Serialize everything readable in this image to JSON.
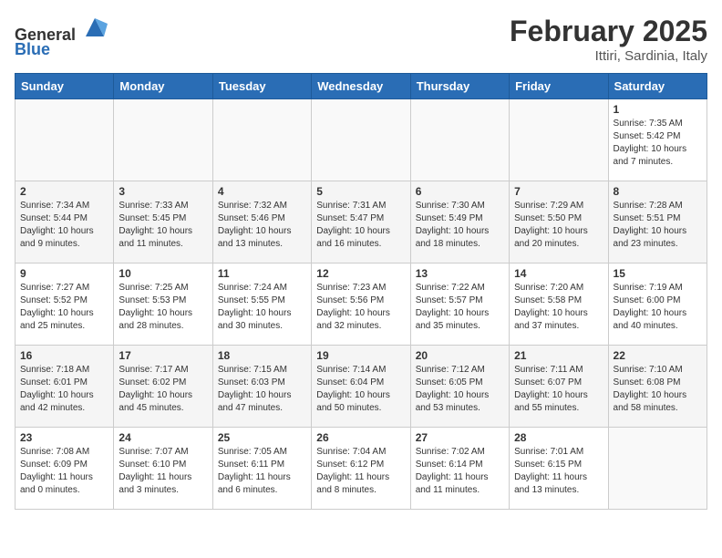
{
  "header": {
    "logo_line1": "General",
    "logo_line2": "Blue",
    "month_title": "February 2025",
    "location": "Ittiri, Sardinia, Italy"
  },
  "days_of_week": [
    "Sunday",
    "Monday",
    "Tuesday",
    "Wednesday",
    "Thursday",
    "Friday",
    "Saturday"
  ],
  "weeks": [
    [
      {
        "day": "",
        "info": ""
      },
      {
        "day": "",
        "info": ""
      },
      {
        "day": "",
        "info": ""
      },
      {
        "day": "",
        "info": ""
      },
      {
        "day": "",
        "info": ""
      },
      {
        "day": "",
        "info": ""
      },
      {
        "day": "1",
        "info": "Sunrise: 7:35 AM\nSunset: 5:42 PM\nDaylight: 10 hours\nand 7 minutes."
      }
    ],
    [
      {
        "day": "2",
        "info": "Sunrise: 7:34 AM\nSunset: 5:44 PM\nDaylight: 10 hours\nand 9 minutes."
      },
      {
        "day": "3",
        "info": "Sunrise: 7:33 AM\nSunset: 5:45 PM\nDaylight: 10 hours\nand 11 minutes."
      },
      {
        "day": "4",
        "info": "Sunrise: 7:32 AM\nSunset: 5:46 PM\nDaylight: 10 hours\nand 13 minutes."
      },
      {
        "day": "5",
        "info": "Sunrise: 7:31 AM\nSunset: 5:47 PM\nDaylight: 10 hours\nand 16 minutes."
      },
      {
        "day": "6",
        "info": "Sunrise: 7:30 AM\nSunset: 5:49 PM\nDaylight: 10 hours\nand 18 minutes."
      },
      {
        "day": "7",
        "info": "Sunrise: 7:29 AM\nSunset: 5:50 PM\nDaylight: 10 hours\nand 20 minutes."
      },
      {
        "day": "8",
        "info": "Sunrise: 7:28 AM\nSunset: 5:51 PM\nDaylight: 10 hours\nand 23 minutes."
      }
    ],
    [
      {
        "day": "9",
        "info": "Sunrise: 7:27 AM\nSunset: 5:52 PM\nDaylight: 10 hours\nand 25 minutes."
      },
      {
        "day": "10",
        "info": "Sunrise: 7:25 AM\nSunset: 5:53 PM\nDaylight: 10 hours\nand 28 minutes."
      },
      {
        "day": "11",
        "info": "Sunrise: 7:24 AM\nSunset: 5:55 PM\nDaylight: 10 hours\nand 30 minutes."
      },
      {
        "day": "12",
        "info": "Sunrise: 7:23 AM\nSunset: 5:56 PM\nDaylight: 10 hours\nand 32 minutes."
      },
      {
        "day": "13",
        "info": "Sunrise: 7:22 AM\nSunset: 5:57 PM\nDaylight: 10 hours\nand 35 minutes."
      },
      {
        "day": "14",
        "info": "Sunrise: 7:20 AM\nSunset: 5:58 PM\nDaylight: 10 hours\nand 37 minutes."
      },
      {
        "day": "15",
        "info": "Sunrise: 7:19 AM\nSunset: 6:00 PM\nDaylight: 10 hours\nand 40 minutes."
      }
    ],
    [
      {
        "day": "16",
        "info": "Sunrise: 7:18 AM\nSunset: 6:01 PM\nDaylight: 10 hours\nand 42 minutes."
      },
      {
        "day": "17",
        "info": "Sunrise: 7:17 AM\nSunset: 6:02 PM\nDaylight: 10 hours\nand 45 minutes."
      },
      {
        "day": "18",
        "info": "Sunrise: 7:15 AM\nSunset: 6:03 PM\nDaylight: 10 hours\nand 47 minutes."
      },
      {
        "day": "19",
        "info": "Sunrise: 7:14 AM\nSunset: 6:04 PM\nDaylight: 10 hours\nand 50 minutes."
      },
      {
        "day": "20",
        "info": "Sunrise: 7:12 AM\nSunset: 6:05 PM\nDaylight: 10 hours\nand 53 minutes."
      },
      {
        "day": "21",
        "info": "Sunrise: 7:11 AM\nSunset: 6:07 PM\nDaylight: 10 hours\nand 55 minutes."
      },
      {
        "day": "22",
        "info": "Sunrise: 7:10 AM\nSunset: 6:08 PM\nDaylight: 10 hours\nand 58 minutes."
      }
    ],
    [
      {
        "day": "23",
        "info": "Sunrise: 7:08 AM\nSunset: 6:09 PM\nDaylight: 11 hours\nand 0 minutes."
      },
      {
        "day": "24",
        "info": "Sunrise: 7:07 AM\nSunset: 6:10 PM\nDaylight: 11 hours\nand 3 minutes."
      },
      {
        "day": "25",
        "info": "Sunrise: 7:05 AM\nSunset: 6:11 PM\nDaylight: 11 hours\nand 6 minutes."
      },
      {
        "day": "26",
        "info": "Sunrise: 7:04 AM\nSunset: 6:12 PM\nDaylight: 11 hours\nand 8 minutes."
      },
      {
        "day": "27",
        "info": "Sunrise: 7:02 AM\nSunset: 6:14 PM\nDaylight: 11 hours\nand 11 minutes."
      },
      {
        "day": "28",
        "info": "Sunrise: 7:01 AM\nSunset: 6:15 PM\nDaylight: 11 hours\nand 13 minutes."
      },
      {
        "day": "",
        "info": ""
      }
    ]
  ]
}
